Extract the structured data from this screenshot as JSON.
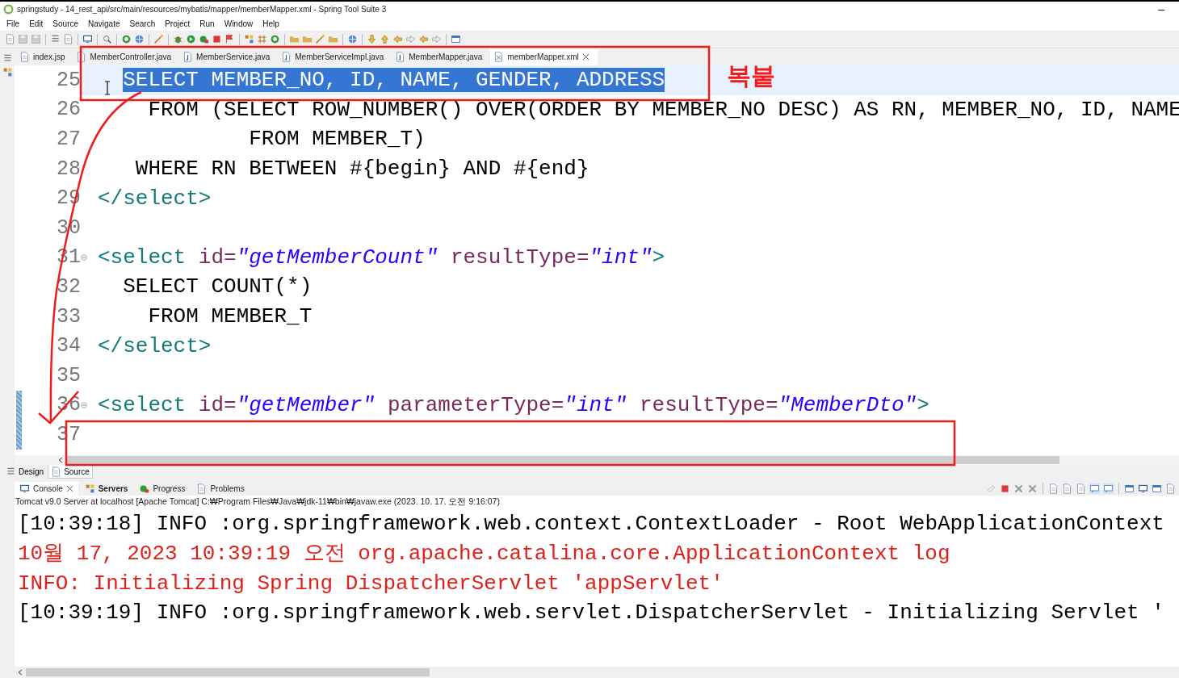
{
  "window": {
    "title": "springstudy - 14_rest_api/src/main/resources/mybatis/mapper/memberMapper.xml - Spring Tool Suite 3",
    "minimize": "–"
  },
  "menu": [
    "File",
    "Edit",
    "Source",
    "Navigate",
    "Search",
    "Project",
    "Run",
    "Window",
    "Help"
  ],
  "editor_tabs": [
    {
      "label": "index.jsp",
      "kind": "jsp",
      "selected": false
    },
    {
      "label": "MemberController.java",
      "kind": "java",
      "selected": false
    },
    {
      "label": "MemberService.java",
      "kind": "java",
      "selected": false
    },
    {
      "label": "MemberServiceImpl.java",
      "kind": "java",
      "selected": false
    },
    {
      "label": "MemberMapper.java",
      "kind": "java",
      "selected": false
    },
    {
      "label": "memberMapper.xml",
      "kind": "xml",
      "selected": true
    }
  ],
  "code_lines": [
    {
      "number": "25",
      "current": true,
      "changed": false,
      "foldable": false,
      "segments": [
        {
          "kind": "selected",
          "text": "  SELECT MEMBER_NO, ID, NAME, GENDER, ADDRESS"
        }
      ]
    },
    {
      "number": "26",
      "current": false,
      "changed": false,
      "foldable": false,
      "segments": [
        {
          "kind": "plain",
          "text": "    FROM (SELECT ROW_NUMBER() OVER(ORDER BY MEMBER_NO DESC) AS RN, MEMBER_NO, ID, NAME"
        }
      ]
    },
    {
      "number": "27",
      "current": false,
      "changed": false,
      "foldable": false,
      "segments": [
        {
          "kind": "plain",
          "text": "            FROM MEMBER_T)"
        }
      ]
    },
    {
      "number": "28",
      "current": false,
      "changed": false,
      "foldable": false,
      "segments": [
        {
          "kind": "plain",
          "text": "   WHERE RN BETWEEN #{begin} AND #{end}"
        }
      ]
    },
    {
      "number": "29",
      "current": false,
      "changed": false,
      "foldable": false,
      "segments": [
        {
          "kind": "tag",
          "text": "</select>"
        }
      ]
    },
    {
      "number": "30",
      "current": false,
      "changed": false,
      "foldable": false
    },
    {
      "number": "31",
      "current": false,
      "changed": false,
      "foldable": true,
      "segments": [
        {
          "kind": "tag",
          "text": "<select "
        },
        {
          "kind": "attr",
          "text": "id="
        },
        {
          "kind": "value",
          "text": "\"getMemberCount\""
        },
        {
          "kind": "attr",
          "text": " resultType="
        },
        {
          "kind": "value",
          "text": "\"int\""
        },
        {
          "kind": "tag",
          "text": ">"
        }
      ]
    },
    {
      "number": "32",
      "current": false,
      "changed": false,
      "foldable": false,
      "segments": [
        {
          "kind": "plain",
          "text": "  SELECT COUNT(*)"
        }
      ]
    },
    {
      "number": "33",
      "current": false,
      "changed": false,
      "foldable": false,
      "segments": [
        {
          "kind": "plain",
          "text": "    FROM MEMBER_T"
        }
      ]
    },
    {
      "number": "34",
      "current": false,
      "changed": false,
      "foldable": false,
      "segments": [
        {
          "kind": "tag",
          "text": "</select>"
        }
      ]
    },
    {
      "number": "35",
      "current": false,
      "changed": false,
      "foldable": false
    },
    {
      "number": "36",
      "current": false,
      "changed": true,
      "foldable": true,
      "segments": [
        {
          "kind": "tag",
          "text": "<select "
        },
        {
          "kind": "attr",
          "text": "id="
        },
        {
          "kind": "value",
          "text": "\"getMember\""
        },
        {
          "kind": "attr",
          "text": " parameterType="
        },
        {
          "kind": "value",
          "text": "\"int\""
        },
        {
          "kind": "attr",
          "text": " resultType="
        },
        {
          "kind": "value",
          "text": "\"MemberDto\""
        },
        {
          "kind": "tag",
          "text": ">"
        }
      ]
    },
    {
      "number": "37",
      "current": false,
      "changed": true,
      "foldable": false
    }
  ],
  "editor_bottom_tabs": [
    {
      "label": "Design",
      "selected": false
    },
    {
      "label": "Source",
      "selected": true
    }
  ],
  "console_tabs": [
    {
      "label": "Console",
      "selected": true,
      "updated": false
    },
    {
      "label": "Servers",
      "selected": false,
      "updated": true
    },
    {
      "label": "Progress",
      "selected": false,
      "updated": false
    },
    {
      "label": "Problems",
      "selected": false,
      "updated": false
    }
  ],
  "console_description": "Tomcat v9.0 Server at localhost [Apache Tomcat] C:₩Program Files₩Java₩jdk-11₩bin₩javaw.exe  (2023. 10. 17. 오전 9:16:07)",
  "console_lines": [
    {
      "kind": "info",
      "text": "[10:39:18] INFO :org.springframework.web.context.ContextLoader - Root WebApplicationContext"
    },
    {
      "kind": "error",
      "text": "10월 17, 2023 10:39:19 오전 org.apache.catalina.core.ApplicationContext log"
    },
    {
      "kind": "error",
      "text": "INFO: Initializing Spring DispatcherServlet 'appServlet'"
    },
    {
      "kind": "info",
      "text": "[10:39:19] INFO :org.springframework.web.servlet.DispatcherServlet - Initializing Servlet '"
    }
  ],
  "annotation": {
    "label": "복붙"
  }
}
